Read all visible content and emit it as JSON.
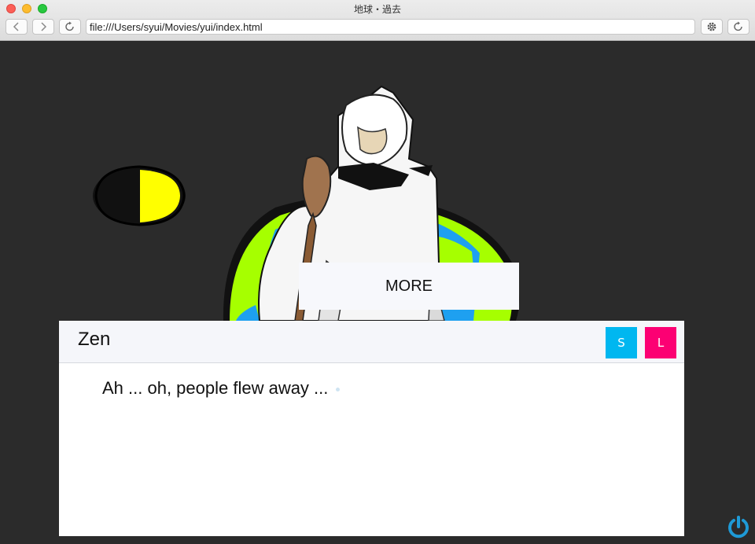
{
  "window": {
    "title": "地球・過去"
  },
  "toolbar": {
    "back_icon": "chevron-left",
    "forward_icon": "chevron-right",
    "reload_icon": "reload",
    "settings_icon": "gear",
    "url": "file:///Users/syui/Movies/yui/index.html"
  },
  "scene": {
    "more_label": "MORE",
    "moon_colors": {
      "left": "#000000",
      "right": "#ffff00"
    },
    "earth_colors": {
      "land": "#a6ff00",
      "ocean": "#1ea0f0"
    }
  },
  "dialog": {
    "speaker": "Zen",
    "message": "Ah ... oh, people flew away ...",
    "s_label": "S",
    "l_label": "L",
    "colors": {
      "s": "#00b7f0",
      "l": "#fc0073"
    }
  }
}
